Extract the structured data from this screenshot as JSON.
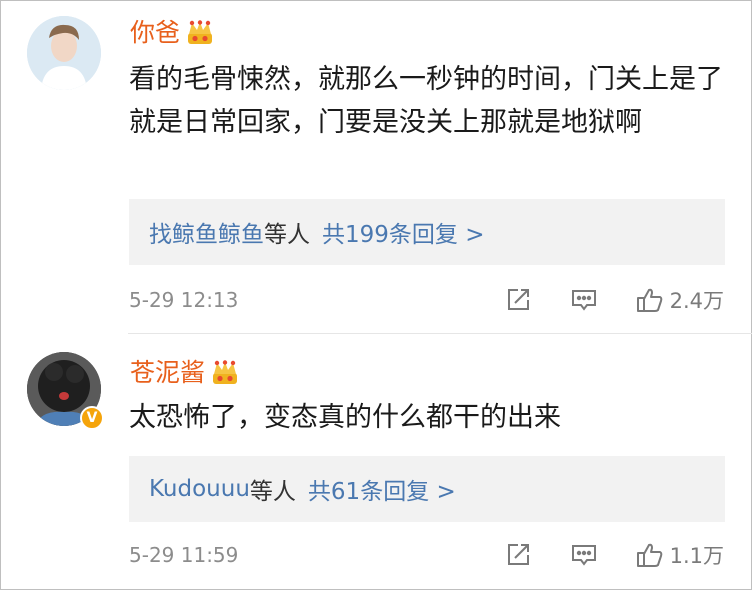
{
  "comments": [
    {
      "username": "你爸",
      "text": "看的毛骨悚然，就那么一秒钟的时间，门关上是了就是日常回家，门要是没关上那就是地狱啊",
      "replies": {
        "who": "找鲸鱼鲸鱼",
        "etc": "等人",
        "count": "共199条回复 >"
      },
      "time": "5-29 12:13",
      "likes": "2.4万",
      "verified": false
    },
    {
      "username": "苍泥酱",
      "text": "太恐怖了，变态真的什么都干的出来",
      "replies": {
        "who": "Kudouuu",
        "etc": "等人",
        "count": "共61条回复 >"
      },
      "time": "5-29 11:59",
      "likes": "1.1万",
      "verified": true,
      "verified_badge": "V"
    }
  ],
  "colors": {
    "username": "#e8601c",
    "reply_link": "#4a78b0",
    "verified": "#f5a40b"
  },
  "icons": [
    "crown-icon",
    "share-icon",
    "comment-icon",
    "like-icon"
  ]
}
